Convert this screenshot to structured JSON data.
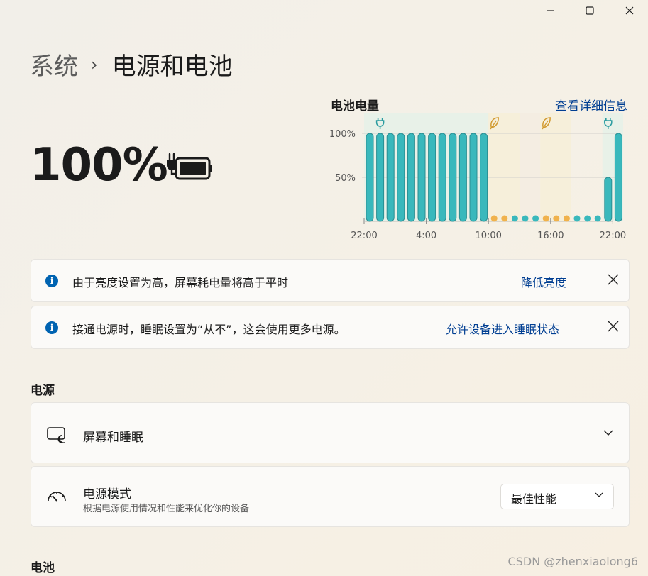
{
  "window": {
    "minimize_icon": "minimize-icon",
    "maximize_icon": "maximize-icon",
    "close_icon": "close-icon"
  },
  "breadcrumb": {
    "parent": "系统",
    "separator": "›",
    "current": "电源和电池"
  },
  "battery": {
    "percent_text": "100%",
    "level": 1.0,
    "icon": "battery-charging-icon"
  },
  "chart_data": {
    "type": "bar",
    "title": "电池电量",
    "link": "查看详细信息",
    "yticks": [
      "100%",
      "50%"
    ],
    "xticks": [
      "22:00",
      "4:00",
      "10:00",
      "16:00",
      "22:00"
    ],
    "ylim": [
      0,
      100
    ],
    "bar_color": "#39b8bc",
    "dot_charging_color": "#39b8bc",
    "dot_saver_color": "#f0b24c",
    "values": [
      100,
      100,
      100,
      100,
      100,
      100,
      100,
      100,
      100,
      100,
      100,
      100,
      0,
      0,
      0,
      0,
      0,
      0,
      0,
      0,
      0,
      0,
      0,
      50,
      100
    ],
    "point_kinds": [
      "bar",
      "bar",
      "bar",
      "bar",
      "bar",
      "bar",
      "bar",
      "bar",
      "bar",
      "bar",
      "bar",
      "bar",
      "saver",
      "saver",
      "teal",
      "teal",
      "teal",
      "saver",
      "saver",
      "saver",
      "teal",
      "teal",
      "teal",
      "bar",
      "bar"
    ],
    "markers": [
      {
        "kind": "plug",
        "index": 1
      },
      {
        "kind": "leaf",
        "index": 12
      },
      {
        "kind": "leaf",
        "index": 17
      },
      {
        "kind": "plug",
        "index": 23
      }
    ]
  },
  "notices": [
    {
      "icon": "info-icon",
      "text": "由于亮度设置为高，屏幕耗电量将高于平时",
      "action": "降低亮度",
      "close_icon": "close-icon"
    },
    {
      "icon": "info-icon",
      "text": "接通电源时，睡眠设置为“从不”，这会使用更多电源。",
      "action": "允许设备进入睡眠状态",
      "close_icon": "close-icon"
    }
  ],
  "power_section": {
    "title": "电源",
    "screen_sleep": {
      "icon": "screen-sleep-icon",
      "label": "屏幕和睡眠",
      "expand_icon": "chevron-down-icon"
    },
    "power_mode": {
      "icon": "gauge-icon",
      "label": "电源模式",
      "description": "根据电源使用情况和性能来优化你的设备",
      "selected": "最佳性能",
      "dropdown_icon": "chevron-down-icon"
    }
  },
  "battery_section": {
    "title": "电池"
  },
  "watermark": "CSDN @zhenxiaolong6"
}
